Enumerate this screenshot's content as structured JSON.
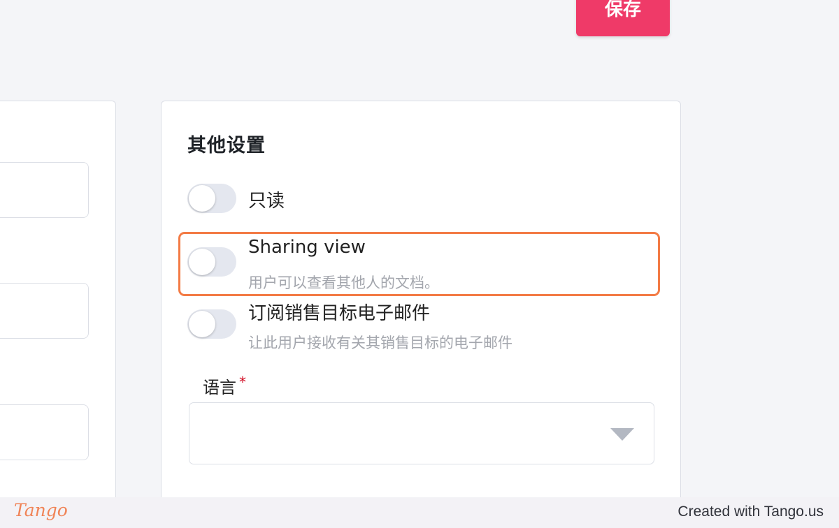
{
  "toolbar": {
    "save_label": "保存"
  },
  "other_settings": {
    "title": "其他设置",
    "options": [
      {
        "label": "只读",
        "description": "",
        "enabled": false
      },
      {
        "label": "Sharing view",
        "description": "用户可以查看其他人的文档。",
        "enabled": false
      },
      {
        "label": "订阅销售目标电子邮件",
        "description": "让此用户接收有关其销售目标的电子邮件",
        "enabled": false
      }
    ],
    "language": {
      "label": "语言",
      "required_mark": "*",
      "value": ""
    }
  },
  "footer": {
    "logo": "Tango",
    "credit": "Created with Tango.us"
  },
  "colors": {
    "save_button": "#ef3a68",
    "highlight": "#f37b45",
    "toggle_off": "#e4e7ef"
  }
}
